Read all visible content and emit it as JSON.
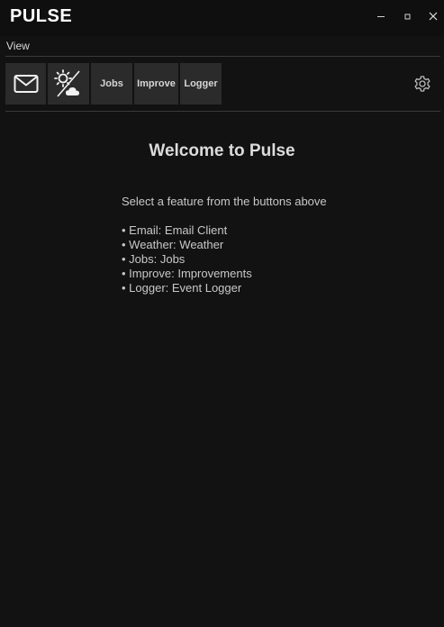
{
  "window": {
    "title": "PULSE",
    "controls": {
      "minimize_icon": "minimize-icon",
      "maximize_icon": "maximize-icon",
      "close_icon": "close-icon"
    }
  },
  "menu": {
    "items": [
      {
        "label": "View"
      }
    ]
  },
  "toolbar": {
    "buttons": [
      {
        "id": "email",
        "icon": "envelope-icon"
      },
      {
        "id": "weather",
        "icon": "sun-cloud-icon"
      },
      {
        "id": "jobs",
        "label": "Jobs"
      },
      {
        "id": "improve",
        "label": "Improve"
      },
      {
        "id": "logger",
        "label": "Logger"
      }
    ],
    "settings_icon": "gear-icon"
  },
  "content": {
    "title": "Welcome to Pulse",
    "subtitle": "Select a feature from the buttons above",
    "features": [
      "• Email: Email Client",
      "• Weather: Weather",
      "• Jobs: Jobs",
      "• Improve: Improvements",
      "• Logger: Event Logger"
    ]
  },
  "colors": {
    "background": "#121212",
    "titlebar": "#0f0f0f",
    "button": "#2b2b2b",
    "text": "#cfcfcf"
  }
}
